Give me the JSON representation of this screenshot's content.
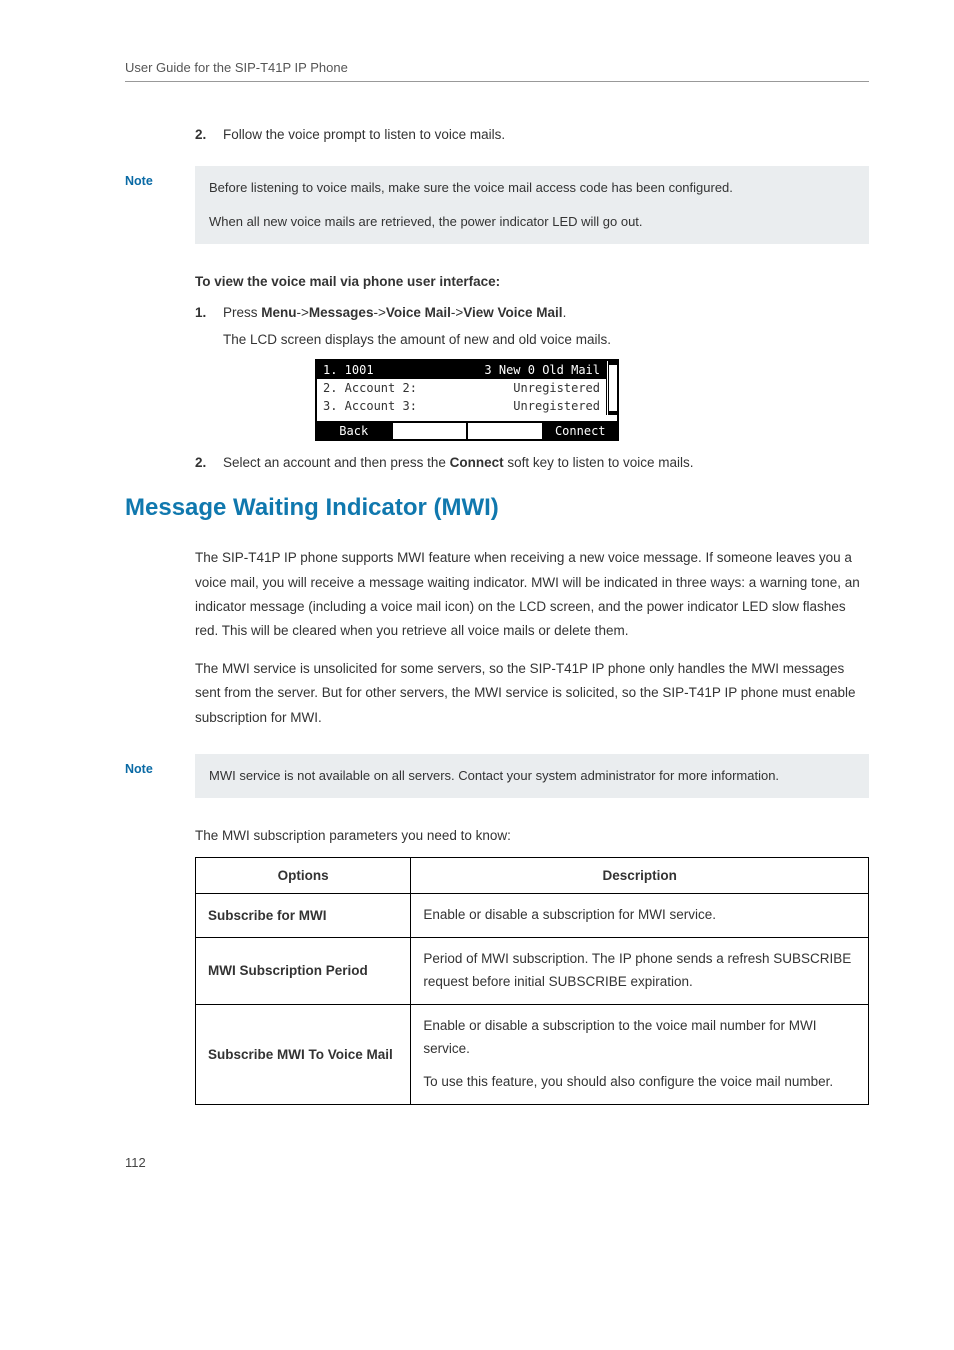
{
  "header": "User Guide for the SIP-T41P IP Phone",
  "steps_a": [
    {
      "num": "2.",
      "text": "Follow the voice prompt to listen to voice mails."
    }
  ],
  "note1": {
    "label": "Note",
    "lines": [
      "Before listening to voice mails, make sure the voice mail access code has been configured.",
      "When all new voice mails are retrieved, the power indicator LED will go out."
    ]
  },
  "section_heading": "To view the voice mail via phone user interface:",
  "steps_b": [
    {
      "num": "1.",
      "prefix": "Press ",
      "bold": "Menu",
      "a1": "->",
      "b1": "Messages",
      "a2": "->",
      "b2": "Voice Mail",
      "a3": "->",
      "b3": "View Voice Mail",
      "suffix": "."
    }
  ],
  "step_b_sub": "The LCD screen displays the amount of new and old voice mails.",
  "lcd": {
    "row1": {
      "left": "1. 1001",
      "right": "3 New 0 Old Mail"
    },
    "row2": {
      "left": "2. Account 2:",
      "right": "Unregistered"
    },
    "row3": {
      "left": "3. Account 3:",
      "right": "Unregistered"
    },
    "softkeys": [
      "Back",
      "",
      "",
      "Connect"
    ]
  },
  "steps_c": [
    {
      "num": "2.",
      "p1": "Select an account and then press the ",
      "b1": "Connect",
      "p2": " soft key to listen to voice mails."
    }
  ],
  "section_title": "Message Waiting Indicator (MWI)",
  "para1": "The SIP-T41P IP phone supports MWI feature when receiving a new voice message. If someone leaves you a voice mail, you will receive a message waiting indicator. MWI will be indicated in three ways: a warning tone, an indicator message (including a voice mail icon) on the LCD screen, and the power indicator LED slow flashes red. This will be cleared when you retrieve all voice mails or delete them.",
  "para2": "The MWI service is unsolicited for some servers, so the SIP-T41P IP phone only handles the MWI messages sent from the server. But for other servers, the MWI service is solicited, so the SIP-T41P IP phone must enable subscription for MWI.",
  "note2": {
    "label": "Note",
    "text": "MWI service is not available on all servers. Contact your system administrator for more information."
  },
  "param_intro": "The MWI subscription parameters you need to know:",
  "table": {
    "headers": [
      "Options",
      "Description"
    ],
    "rows": [
      {
        "option": "Subscribe for MWI",
        "desc": [
          "Enable or disable a subscription for MWI service."
        ]
      },
      {
        "option": "MWI Subscription Period",
        "desc": [
          "Period of MWI subscription. The IP phone sends a refresh SUBSCRIBE request before initial SUBSCRIBE expiration."
        ]
      },
      {
        "option": "Subscribe MWI To Voice Mail",
        "desc": [
          "Enable or disable a subscription to the voice mail number for MWI service.",
          "To use this feature, you should also configure the voice mail number."
        ]
      }
    ]
  },
  "page_number": "112"
}
